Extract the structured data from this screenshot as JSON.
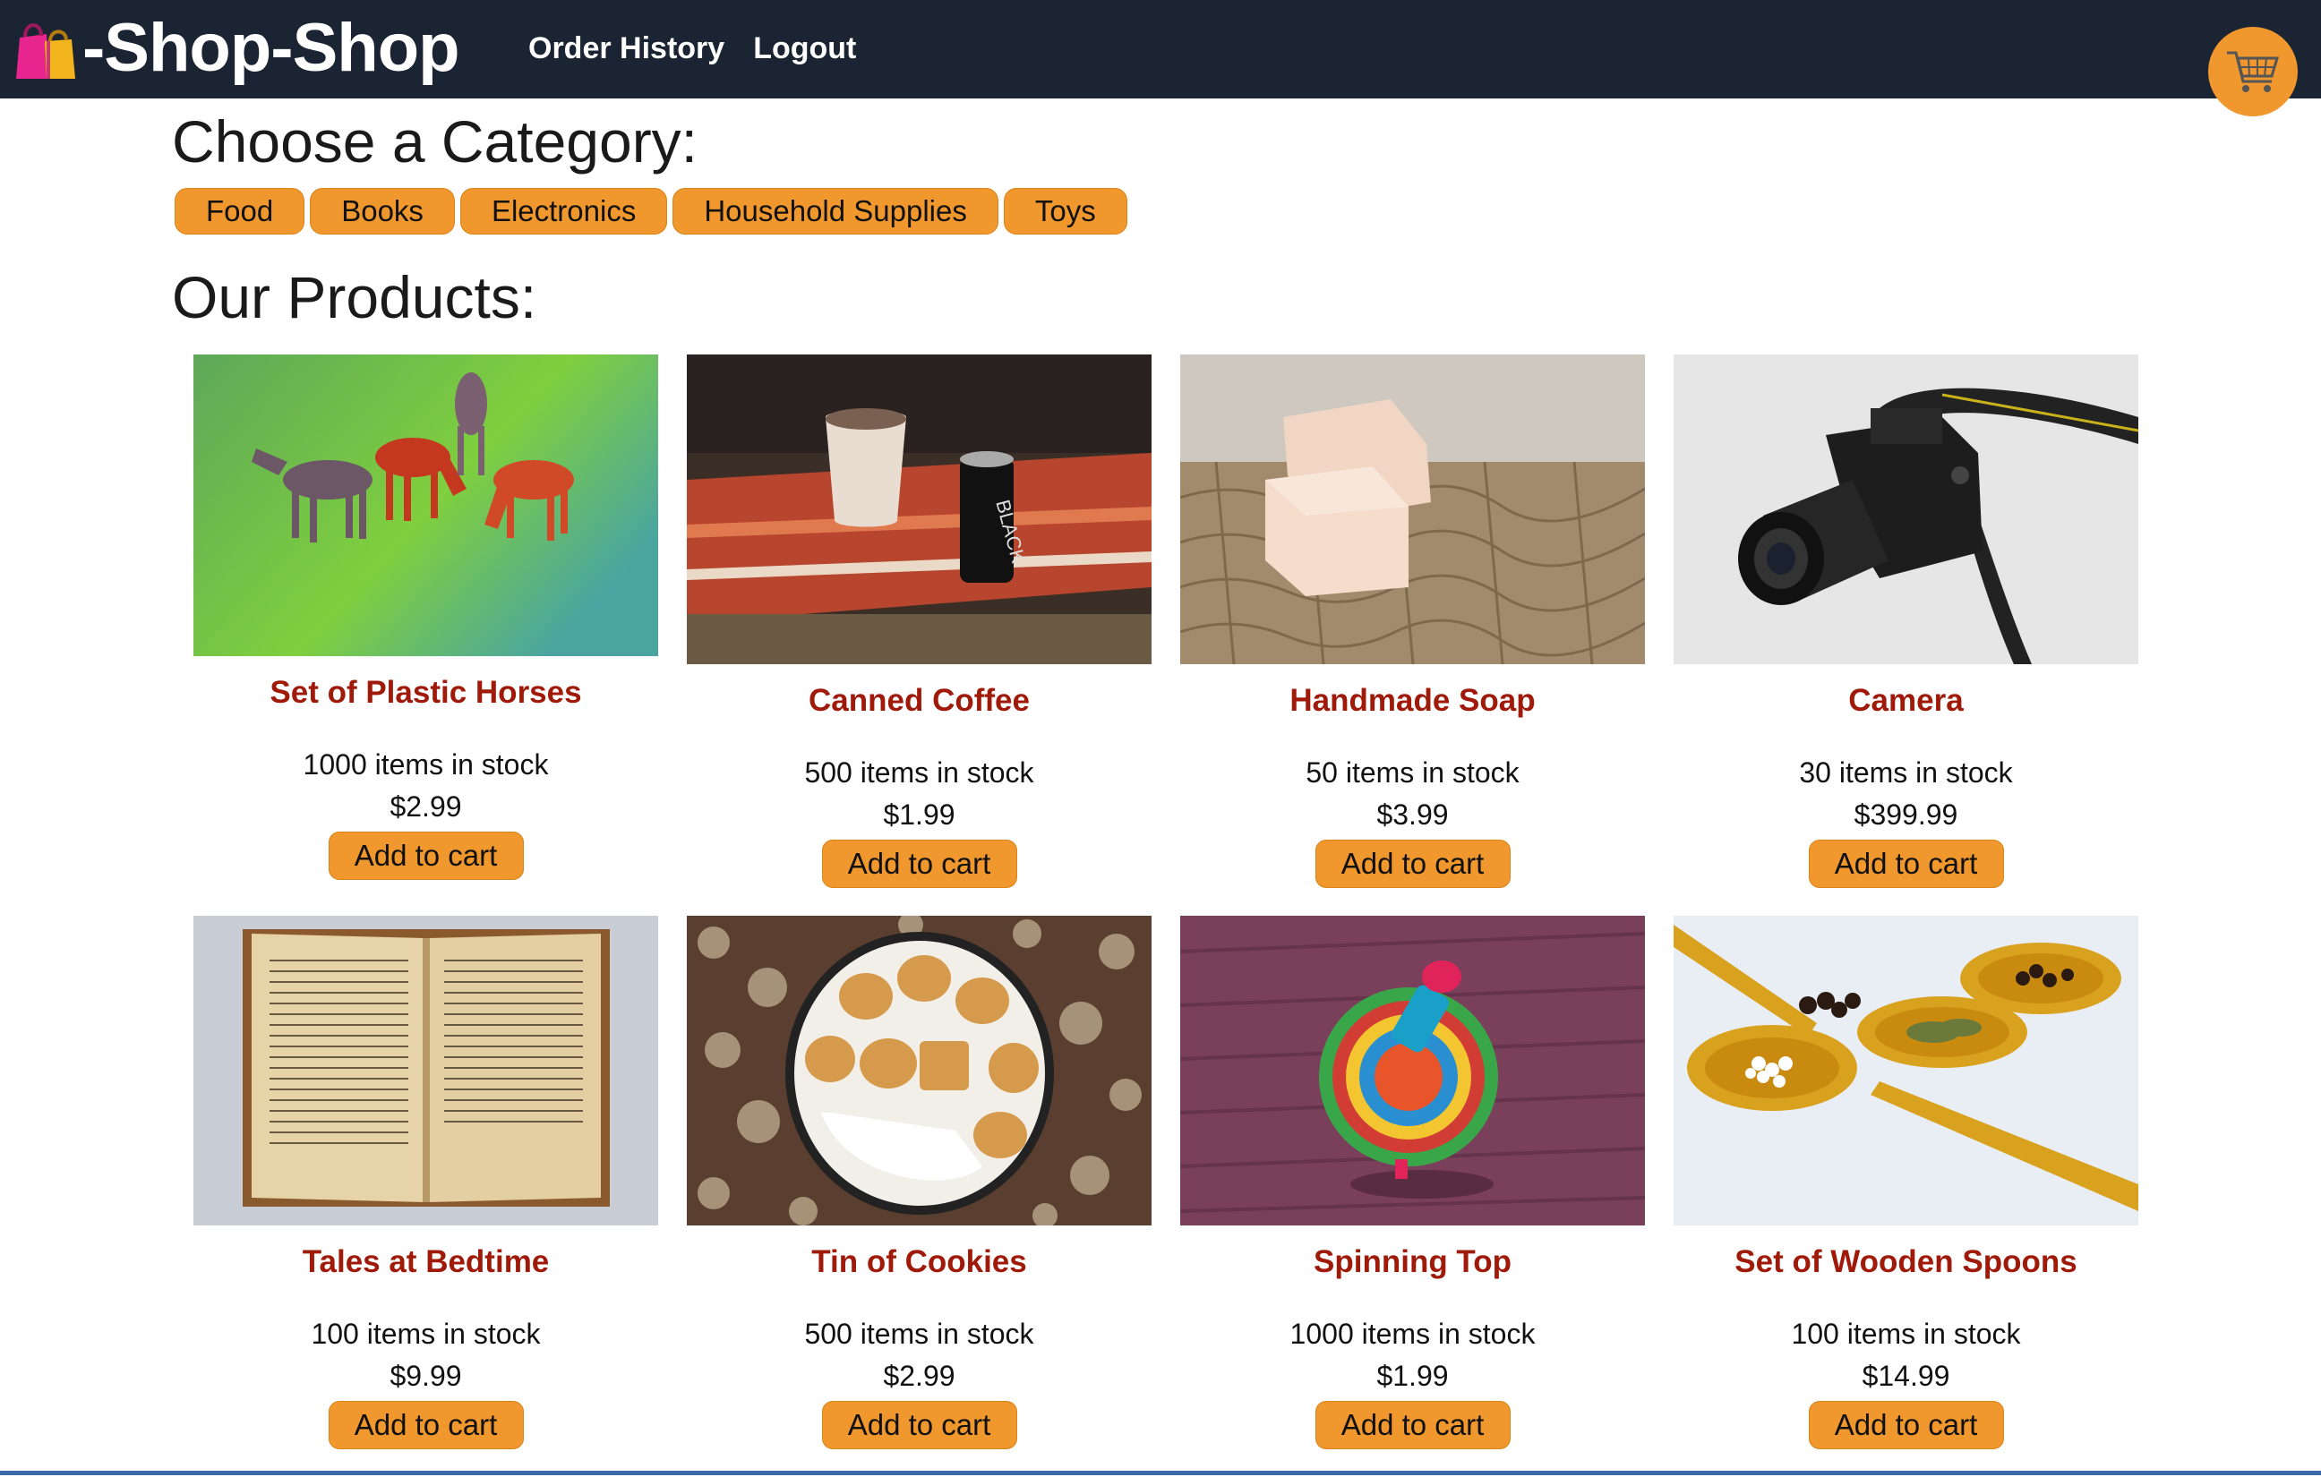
{
  "header": {
    "brand": "-Shop-Shop",
    "nav": [
      "Order History",
      "Logout"
    ],
    "brand_icon": "shopping-bags-icon",
    "cart_icon": "shopping-cart-icon",
    "bg_color": "#1b2433",
    "accent_color": "#f0972d"
  },
  "categories": {
    "title": "Choose a Category:",
    "items": [
      "Food",
      "Books",
      "Electronics",
      "Household Supplies",
      "Toys"
    ]
  },
  "products": {
    "title": "Our Products:",
    "add_label": "Add to cart",
    "items": [
      {
        "name": "Set of Plastic Horses",
        "stock": "1000 items in stock",
        "price": "$2.99",
        "image": "plastic-horses"
      },
      {
        "name": "Canned Coffee",
        "stock": "500 items in stock",
        "price": "$1.99",
        "image": "canned-coffee"
      },
      {
        "name": "Handmade Soap",
        "stock": "50 items in stock",
        "price": "$3.99",
        "image": "handmade-soap"
      },
      {
        "name": "Camera",
        "stock": "30 items in stock",
        "price": "$399.99",
        "image": "camera"
      },
      {
        "name": "Tales at Bedtime",
        "stock": "100 items in stock",
        "price": "$9.99",
        "image": "open-book"
      },
      {
        "name": "Tin of Cookies",
        "stock": "500 items in stock",
        "price": "$2.99",
        "image": "cookie-tin"
      },
      {
        "name": "Spinning Top",
        "stock": "1000 items in stock",
        "price": "$1.99",
        "image": "spinning-top"
      },
      {
        "name": "Set of Wooden Spoons",
        "stock": "100 items in stock",
        "price": "$14.99",
        "image": "wooden-spoons"
      }
    ]
  }
}
